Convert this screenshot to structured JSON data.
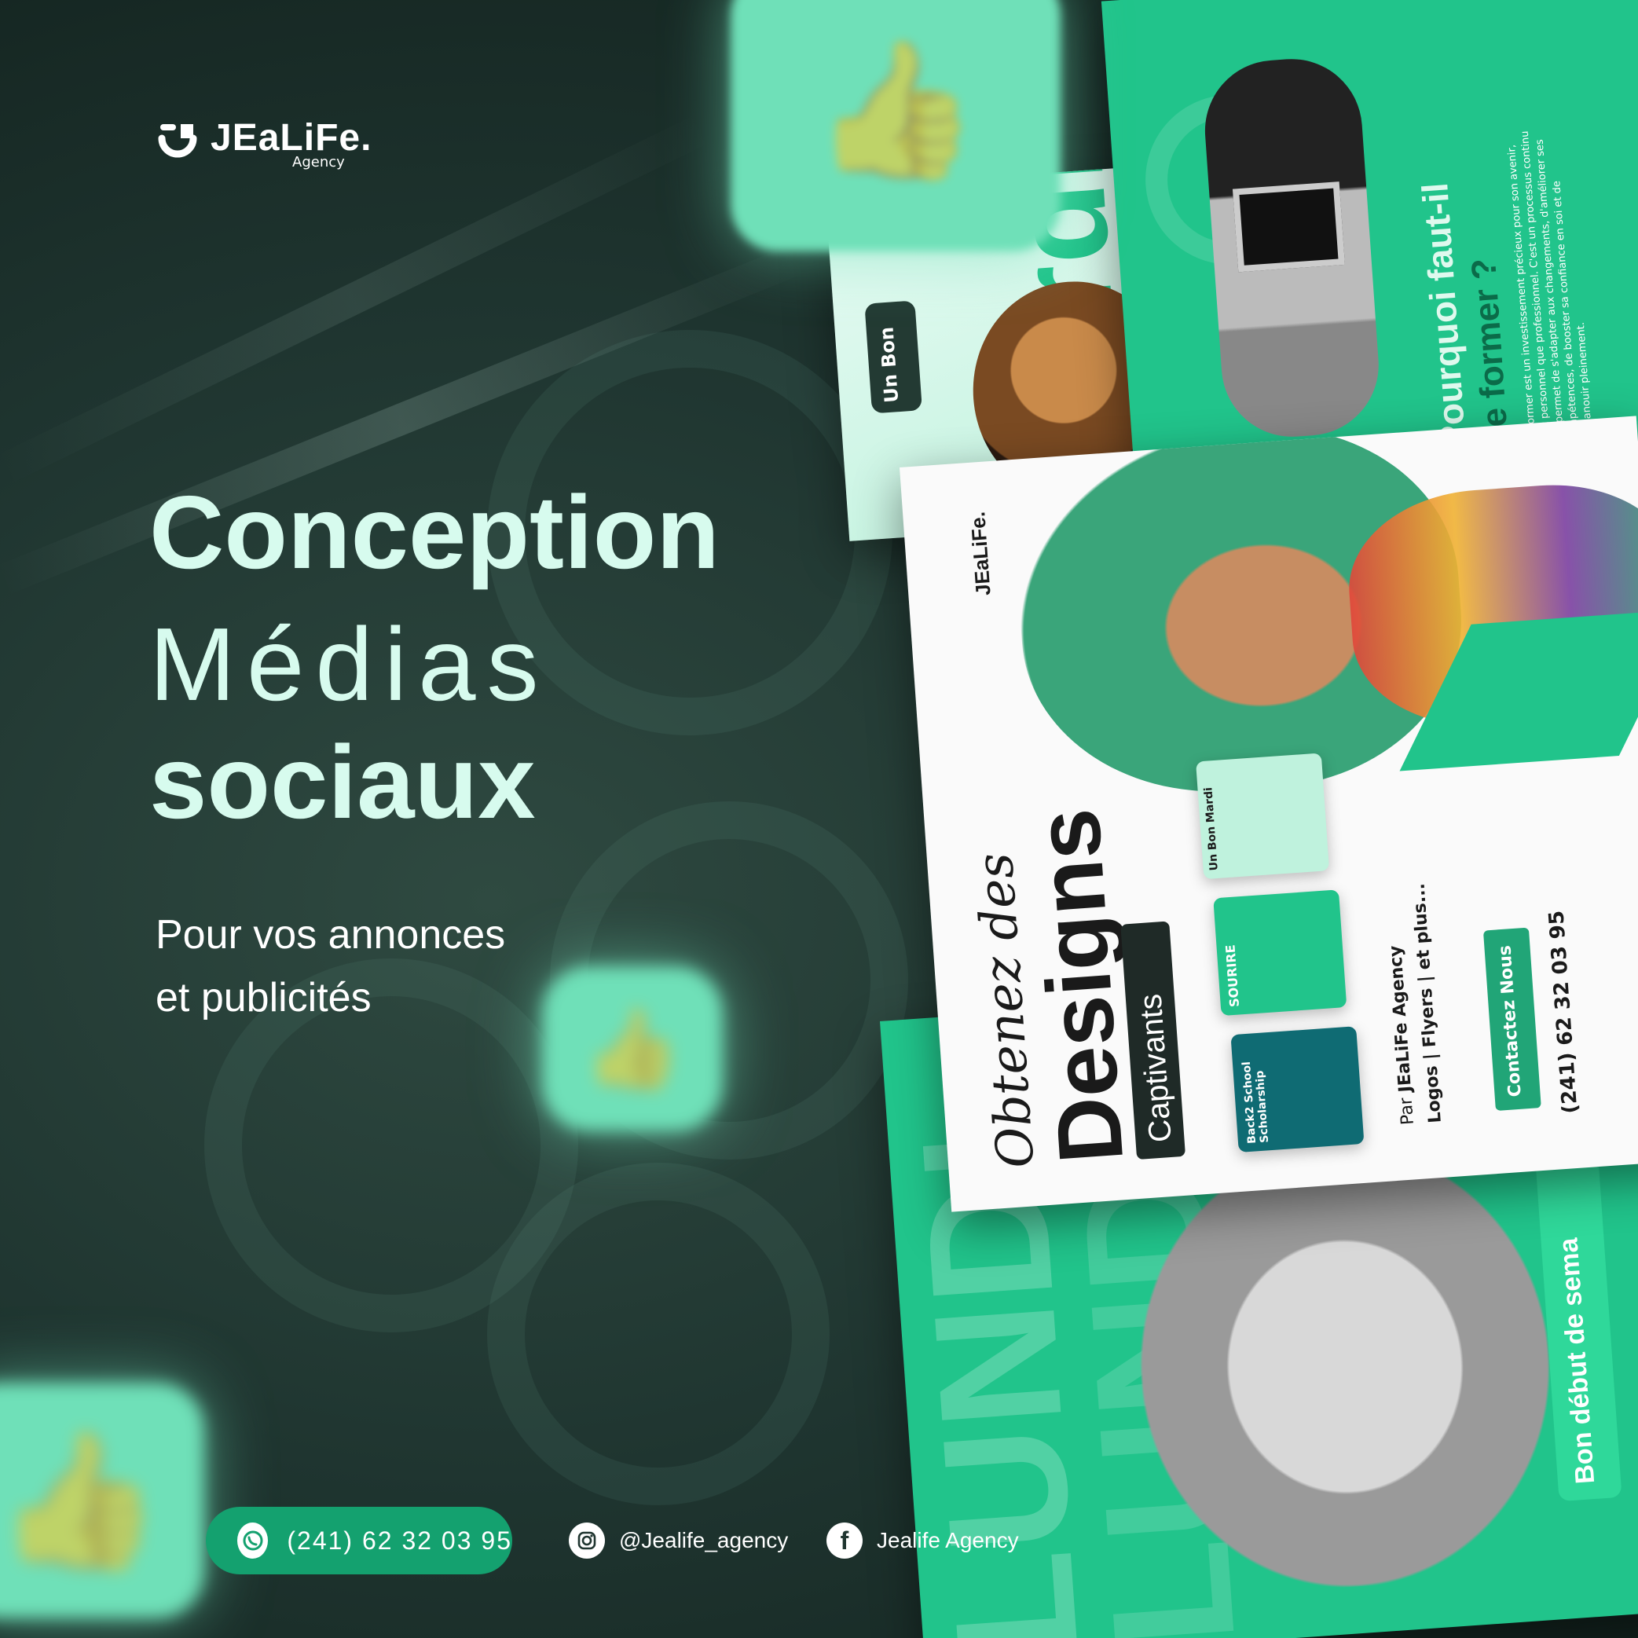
{
  "brand": {
    "name": "JEaLiFe.",
    "tagline": "Agency"
  },
  "headline": {
    "line1": "Conception",
    "line2": "Médias",
    "line3": "sociaux"
  },
  "subtitle": {
    "line1": "Pour vos annonces",
    "line2": "et publicités"
  },
  "contact": {
    "phone": "(241) 62 32 03 95",
    "instagram": "@Jealife_agency",
    "facebook": "Jealife Agency"
  },
  "cards": {
    "training": {
      "title_line1": "Pourquoi faut-il",
      "title_line2": "se former ?",
      "body": "Se former est un investissement précieux pour son avenir, tant personnel que professionnel. C'est un processus continu qui permet de s'adapter aux changements, d'améliorer ses compétences, de booster sa confiance en soi et de s'épanouir pleinement."
    },
    "mardi": {
      "badge": "Un Bon",
      "big": "Mardi"
    },
    "designs": {
      "script": "Obtenez des",
      "title": "Designs",
      "tag": "Captivants",
      "by_prefix": "Par",
      "by_name": "JEaLiFe Agency",
      "services": [
        "Logos",
        "Flyers",
        "et plus..."
      ],
      "cta": "Contactez Nous",
      "phone": "(241) 62 32 03 95",
      "thumbs": [
        "Un Bon Mardi",
        "SOURIRE",
        "Back2 School Scholarship"
      ]
    },
    "lundi": {
      "big": "LUNDI",
      "caption": "Bon début de sema"
    }
  },
  "icons": [
    "logo-mark-icon",
    "whatsapp-icon",
    "instagram-icon",
    "facebook-icon",
    "thumbs-up-icon"
  ],
  "colors": {
    "accent": "#21c48b",
    "mint": "#d7fbee",
    "dark": "#1f3530",
    "pill": "#14a16f"
  }
}
